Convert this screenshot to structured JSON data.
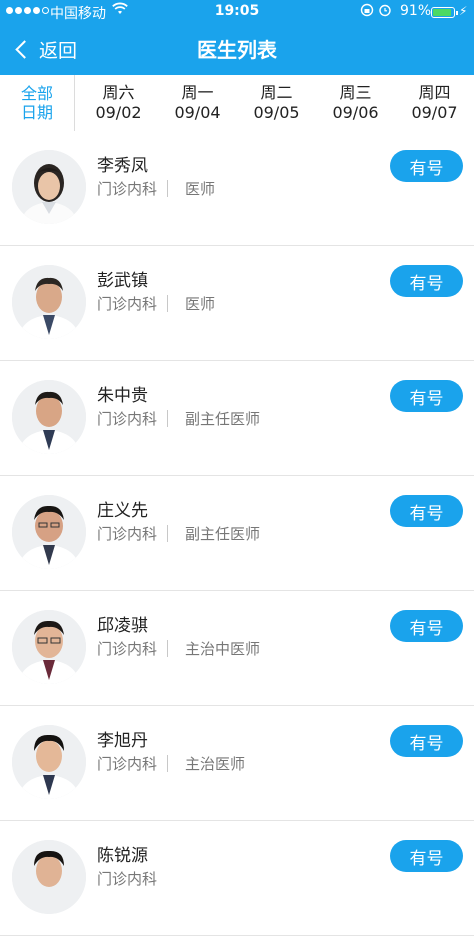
{
  "status": {
    "carrier": "中国移动",
    "time": "19:05",
    "battery": "91%",
    "battery_level": 0.91
  },
  "nav": {
    "back_label": "返回",
    "title": "医生列表"
  },
  "dates": {
    "all_line1": "全部",
    "all_line2": "日期",
    "days": [
      {
        "weekday": "周六",
        "date": "09/02"
      },
      {
        "weekday": "周一",
        "date": "09/04"
      },
      {
        "weekday": "周二",
        "date": "09/05"
      },
      {
        "weekday": "周三",
        "date": "09/06"
      },
      {
        "weekday": "周四",
        "date": "09/07"
      }
    ]
  },
  "doctors": [
    {
      "name": "李秀凤",
      "dept": "门诊内科",
      "title": "医师",
      "status": "有号"
    },
    {
      "name": "彭武镇",
      "dept": "门诊内科",
      "title": "医师",
      "status": "有号"
    },
    {
      "name": "朱中贵",
      "dept": "门诊内科",
      "title": "副主任医师",
      "status": "有号"
    },
    {
      "name": "庄义先",
      "dept": "门诊内科",
      "title": "副主任医师",
      "status": "有号"
    },
    {
      "name": "邱凌骐",
      "dept": "门诊内科",
      "title": "主治中医师",
      "status": "有号"
    },
    {
      "name": "李旭丹",
      "dept": "门诊内科",
      "title": "主治医师",
      "status": "有号"
    },
    {
      "name": "陈锐源",
      "dept": "门诊内科",
      "title": "",
      "status": "有号"
    }
  ],
  "colors": {
    "primary": "#1aa3ec",
    "battery_fill": "#4cd964"
  },
  "icons": {
    "back": "chevron-left-icon",
    "wifi": "wifi-icon",
    "lock": "rotation-lock-icon",
    "alarm": "alarm-icon",
    "charging": "bolt-icon"
  }
}
